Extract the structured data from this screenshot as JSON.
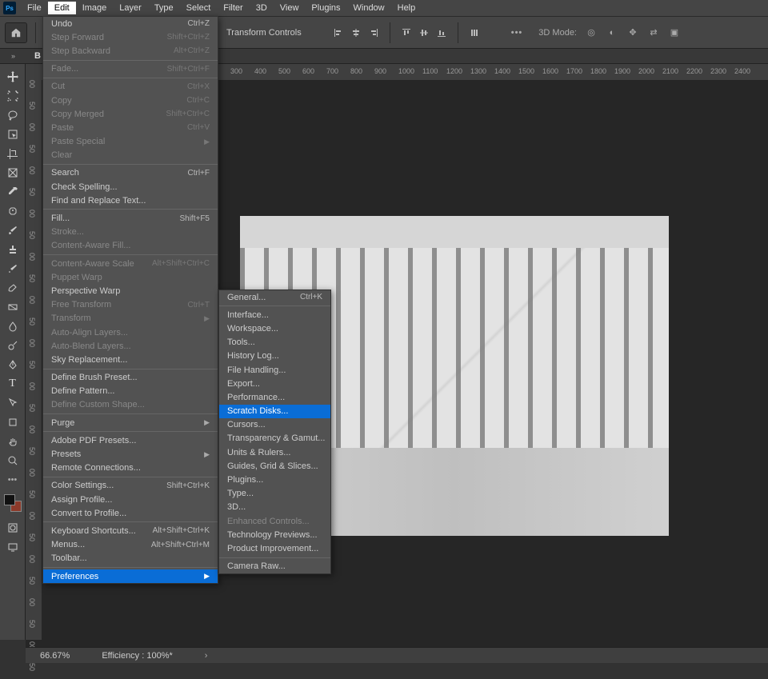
{
  "logo_text": "Ps",
  "menubar": [
    "File",
    "Edit",
    "Image",
    "Layer",
    "Type",
    "Select",
    "Filter",
    "3D",
    "View",
    "Plugins",
    "Window",
    "Help"
  ],
  "menubar_open_index": 1,
  "options": {
    "transform_label": "Transform Controls",
    "mode3d_label": "3D Mode:"
  },
  "thin": {
    "doc_letter": "B"
  },
  "ruler_h": [
    "300",
    "400",
    "500",
    "600",
    "700",
    "800",
    "900",
    "1000",
    "1100",
    "1200",
    "1300",
    "1400",
    "1500",
    "1600",
    "1700",
    "1800",
    "1900",
    "2000",
    "2100",
    "2200",
    "2300",
    "2400"
  ],
  "ruler_v": [
    "00",
    "50",
    "00",
    "50",
    "00",
    "50",
    "00",
    "50",
    "00",
    "50",
    "00",
    "50",
    "00",
    "50",
    "00",
    "50",
    "00",
    "50",
    "00",
    "50",
    "00",
    "50",
    "00",
    "50",
    "00",
    "50",
    "00",
    "50"
  ],
  "edit_menu": [
    {
      "label": "Undo",
      "shortcut": "Ctrl+Z",
      "type": "item"
    },
    {
      "label": "Step Forward",
      "shortcut": "Shift+Ctrl+Z",
      "type": "item",
      "disabled": true
    },
    {
      "label": "Step Backward",
      "shortcut": "Alt+Ctrl+Z",
      "type": "item",
      "disabled": true
    },
    {
      "type": "sep"
    },
    {
      "label": "Fade...",
      "shortcut": "Shift+Ctrl+F",
      "type": "item",
      "disabled": true
    },
    {
      "type": "sep"
    },
    {
      "label": "Cut",
      "shortcut": "Ctrl+X",
      "type": "item",
      "disabled": true
    },
    {
      "label": "Copy",
      "shortcut": "Ctrl+C",
      "type": "item",
      "disabled": true
    },
    {
      "label": "Copy Merged",
      "shortcut": "Shift+Ctrl+C",
      "type": "item",
      "disabled": true
    },
    {
      "label": "Paste",
      "shortcut": "Ctrl+V",
      "type": "item",
      "disabled": true
    },
    {
      "label": "Paste Special",
      "type": "submenu",
      "disabled": true
    },
    {
      "label": "Clear",
      "type": "item",
      "disabled": true
    },
    {
      "type": "sep"
    },
    {
      "label": "Search",
      "shortcut": "Ctrl+F",
      "type": "item"
    },
    {
      "label": "Check Spelling...",
      "type": "item"
    },
    {
      "label": "Find and Replace Text...",
      "type": "item"
    },
    {
      "type": "sep"
    },
    {
      "label": "Fill...",
      "shortcut": "Shift+F5",
      "type": "item"
    },
    {
      "label": "Stroke...",
      "type": "item",
      "disabled": true
    },
    {
      "label": "Content-Aware Fill...",
      "type": "item",
      "disabled": true
    },
    {
      "type": "sep"
    },
    {
      "label": "Content-Aware Scale",
      "shortcut": "Alt+Shift+Ctrl+C",
      "type": "item",
      "disabled": true
    },
    {
      "label": "Puppet Warp",
      "type": "item",
      "disabled": true
    },
    {
      "label": "Perspective Warp",
      "type": "item"
    },
    {
      "label": "Free Transform",
      "shortcut": "Ctrl+T",
      "type": "item",
      "disabled": true
    },
    {
      "label": "Transform",
      "type": "submenu",
      "disabled": true
    },
    {
      "label": "Auto-Align Layers...",
      "type": "item",
      "disabled": true
    },
    {
      "label": "Auto-Blend Layers...",
      "type": "item",
      "disabled": true
    },
    {
      "label": "Sky Replacement...",
      "type": "item"
    },
    {
      "type": "sep"
    },
    {
      "label": "Define Brush Preset...",
      "type": "item"
    },
    {
      "label": "Define Pattern...",
      "type": "item"
    },
    {
      "label": "Define Custom Shape...",
      "type": "item",
      "disabled": true
    },
    {
      "type": "sep"
    },
    {
      "label": "Purge",
      "type": "submenu"
    },
    {
      "type": "sep"
    },
    {
      "label": "Adobe PDF Presets...",
      "type": "item"
    },
    {
      "label": "Presets",
      "type": "submenu"
    },
    {
      "label": "Remote Connections...",
      "type": "item"
    },
    {
      "type": "sep"
    },
    {
      "label": "Color Settings...",
      "shortcut": "Shift+Ctrl+K",
      "type": "item"
    },
    {
      "label": "Assign Profile...",
      "type": "item"
    },
    {
      "label": "Convert to Profile...",
      "type": "item"
    },
    {
      "type": "sep"
    },
    {
      "label": "Keyboard Shortcuts...",
      "shortcut": "Alt+Shift+Ctrl+K",
      "type": "item"
    },
    {
      "label": "Menus...",
      "shortcut": "Alt+Shift+Ctrl+M",
      "type": "item"
    },
    {
      "label": "Toolbar...",
      "type": "item"
    },
    {
      "type": "sep"
    },
    {
      "label": "Preferences",
      "type": "submenu",
      "highlight": true
    }
  ],
  "prefs_menu": [
    {
      "label": "General...",
      "shortcut": "Ctrl+K",
      "type": "item"
    },
    {
      "type": "sep"
    },
    {
      "label": "Interface...",
      "type": "item"
    },
    {
      "label": "Workspace...",
      "type": "item"
    },
    {
      "label": "Tools...",
      "type": "item"
    },
    {
      "label": "History Log...",
      "type": "item"
    },
    {
      "label": "File Handling...",
      "type": "item"
    },
    {
      "label": "Export...",
      "type": "item"
    },
    {
      "label": "Performance...",
      "type": "item"
    },
    {
      "label": "Scratch Disks...",
      "type": "item",
      "highlight": true
    },
    {
      "label": "Cursors...",
      "type": "item"
    },
    {
      "label": "Transparency & Gamut...",
      "type": "item"
    },
    {
      "label": "Units & Rulers...",
      "type": "item"
    },
    {
      "label": "Guides, Grid & Slices...",
      "type": "item"
    },
    {
      "label": "Plugins...",
      "type": "item"
    },
    {
      "label": "Type...",
      "type": "item"
    },
    {
      "label": "3D...",
      "type": "item"
    },
    {
      "label": "Enhanced Controls...",
      "type": "item",
      "disabled": true
    },
    {
      "label": "Technology Previews...",
      "type": "item"
    },
    {
      "label": "Product Improvement...",
      "type": "item"
    },
    {
      "type": "sep"
    },
    {
      "label": "Camera Raw...",
      "type": "item"
    }
  ],
  "status": {
    "zoom": "66.67%",
    "eff": "Efficiency : 100%*"
  },
  "tools": [
    "move",
    "marquee",
    "lasso",
    "select",
    "crop",
    "frame",
    "eyedrop",
    "heal",
    "brush",
    "stamp",
    "history",
    "eraser",
    "gradient",
    "blur",
    "dodge",
    "pen",
    "type",
    "path",
    "shape",
    "hand",
    "zoom",
    "more",
    "swatch",
    "qmask",
    "screen"
  ]
}
